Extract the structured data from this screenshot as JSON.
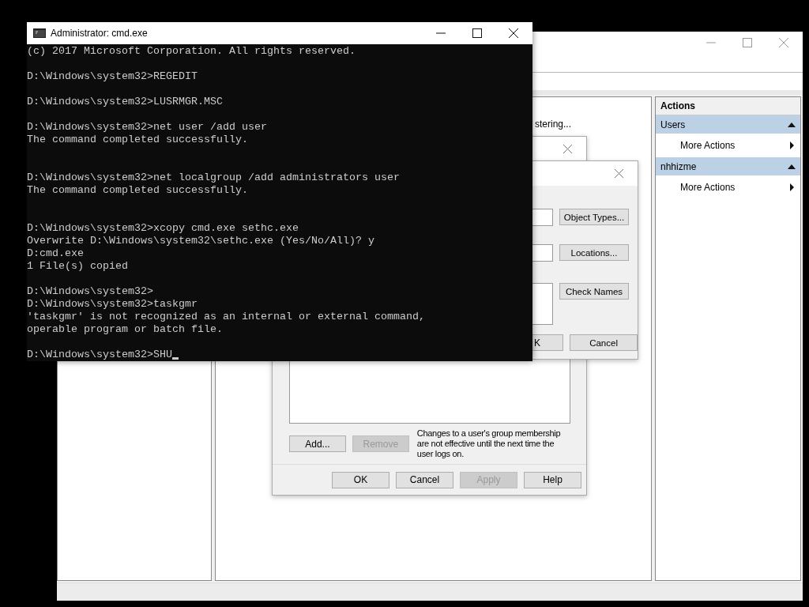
{
  "console_window": {
    "title": "Administrator: cmd.exe",
    "lines": [
      {
        "kind": "text",
        "text": "(c) 2017 Microsoft Corporation. All rights reserved."
      },
      {
        "kind": "blank"
      },
      {
        "kind": "text",
        "text": "D:\\Windows\\system32>REGEDIT"
      },
      {
        "kind": "blank"
      },
      {
        "kind": "text",
        "text": "D:\\Windows\\system32>LUSRMGR.MSC"
      },
      {
        "kind": "blank"
      },
      {
        "kind": "text",
        "text": "D:\\Windows\\system32>net user /add user"
      },
      {
        "kind": "text",
        "text": "The command completed successfully."
      },
      {
        "kind": "blank"
      },
      {
        "kind": "blank"
      },
      {
        "kind": "text",
        "text": "D:\\Windows\\system32>net localgroup /add administrators user"
      },
      {
        "kind": "text",
        "text": "The command completed successfully."
      },
      {
        "kind": "blank"
      },
      {
        "kind": "blank"
      },
      {
        "kind": "text",
        "text": "D:\\Windows\\system32>xcopy cmd.exe sethc.exe"
      },
      {
        "kind": "text",
        "text": "Overwrite D:\\Windows\\system32\\sethc.exe (Yes/No/All)? y"
      },
      {
        "kind": "text",
        "text": "D:cmd.exe"
      },
      {
        "kind": "text",
        "text": "1 File(s) copied"
      },
      {
        "kind": "blank"
      },
      {
        "kind": "text",
        "text": "D:\\Windows\\system32>"
      },
      {
        "kind": "text",
        "text": "D:\\Windows\\system32>taskgmr"
      },
      {
        "kind": "text",
        "text": "'taskgmr' is not recognized as an internal or external command,"
      },
      {
        "kind": "text",
        "text": "operable program or batch file."
      },
      {
        "kind": "blank"
      },
      {
        "kind": "text",
        "text": "D:\\Windows\\system32>SHU"
      }
    ],
    "cursor": true
  },
  "mmc_window": {
    "middle_pane": {
      "status_text": "stering..."
    },
    "actions_pane": {
      "header": "Actions",
      "sections": [
        {
          "title": "Users",
          "expanded": true,
          "items": [
            {
              "label": "More Actions"
            }
          ]
        },
        {
          "title": "nhhizme",
          "expanded": true,
          "items": [
            {
              "label": "More Actions"
            }
          ]
        }
      ]
    }
  },
  "properties_dialog": {
    "list_buttons": [
      {
        "label": "Add...",
        "disabled": false
      },
      {
        "label": "Remove",
        "disabled": true
      }
    ],
    "note": "Changes to a user's group membership are not effective until the next time the user logs on.",
    "buttons": [
      {
        "label": "OK",
        "disabled": false
      },
      {
        "label": "Cancel",
        "disabled": false
      },
      {
        "label": "Apply",
        "disabled": true
      },
      {
        "label": "Help",
        "disabled": false
      }
    ]
  },
  "select_users_dialog": {
    "side_buttons": [
      {
        "label": "Object Types..."
      },
      {
        "label": "Locations..."
      },
      {
        "label": "Check Names"
      }
    ],
    "footer_buttons": [
      {
        "label": "K"
      },
      {
        "label": "Cancel"
      }
    ]
  }
}
